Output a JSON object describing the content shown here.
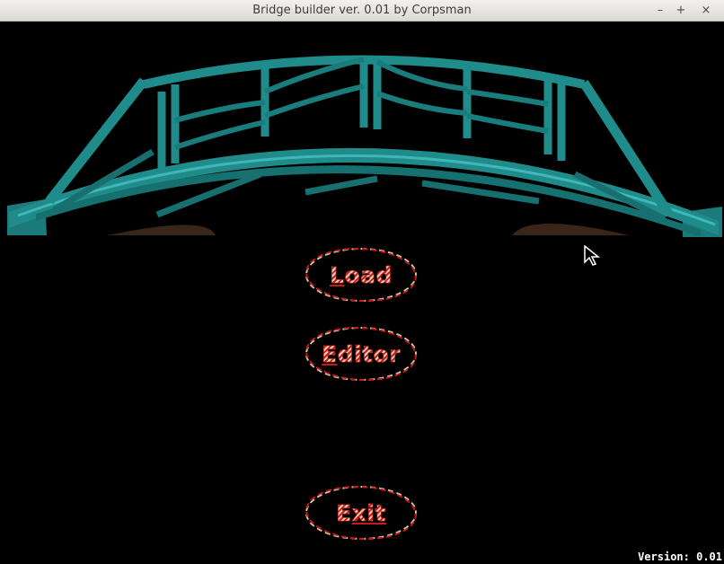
{
  "window": {
    "title": "Bridge builder ver. 0.01 by Corpsman"
  },
  "controls": {
    "minimize": "–",
    "maximize": "+",
    "close": "×"
  },
  "menu": {
    "load": {
      "first": "L",
      "rest": "oad"
    },
    "editor": {
      "first": "E",
      "rest": "ditor"
    },
    "exit": {
      "first": "E",
      "rest": "xit"
    }
  },
  "status": {
    "version": "Version: 0.01"
  },
  "colors": {
    "bridge": "#1e8585",
    "bridge_highlight": "#2aa3a3",
    "button_border": "#c81818",
    "button_fill": "#e8d4b0"
  },
  "icons": {
    "cursor": "pointer-arrow-icon"
  }
}
